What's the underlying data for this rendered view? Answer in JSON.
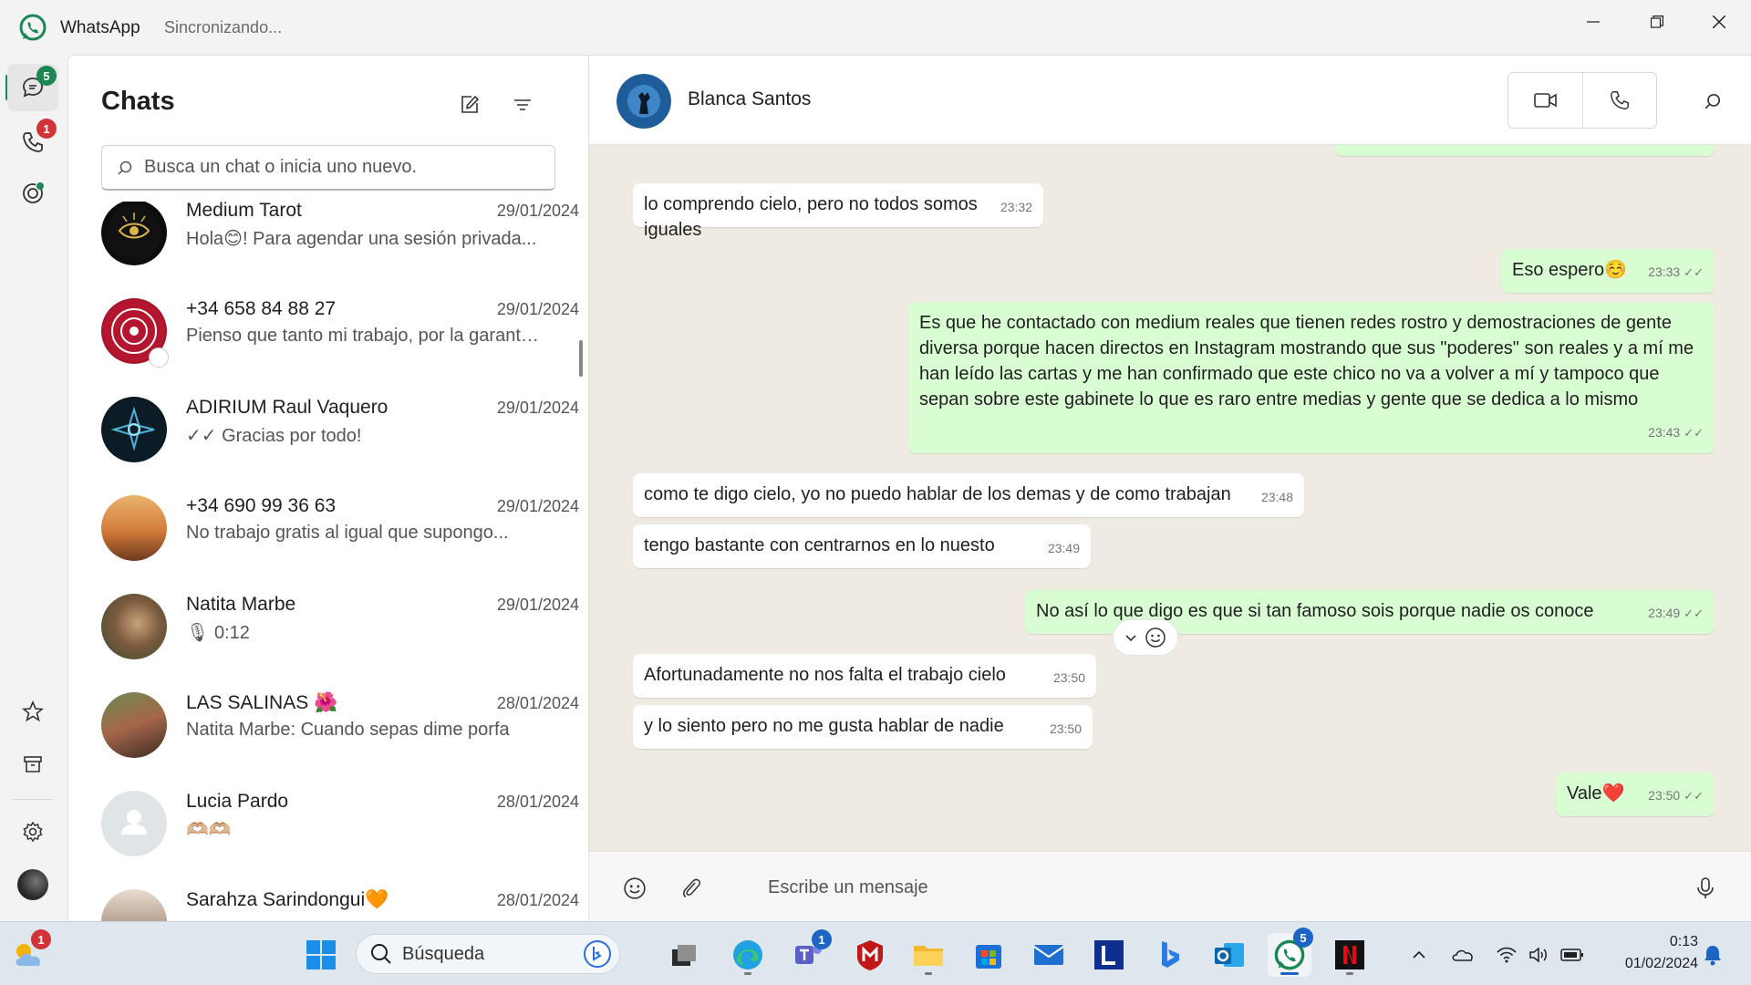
{
  "window": {
    "app_name": "WhatsApp",
    "status": "Sincronizando..."
  },
  "rail": {
    "chats_badge": "5",
    "calls_badge": "1"
  },
  "chatlist": {
    "title": "Chats",
    "search_placeholder": "Busca un chat o inicia uno nuevo.",
    "items": [
      {
        "name": "Medium Tarot",
        "date": "29/01/2024",
        "preview": "Hola😊! Para agendar una sesión privada..."
      },
      {
        "name": "+34 658 84 88 27",
        "date": "29/01/2024",
        "preview": "Pienso que tanto mi trabajo, por la garantía..."
      },
      {
        "name": "ADIRIUM Raul Vaquero",
        "date": "29/01/2024",
        "preview": "✓✓ Gracias por todo!"
      },
      {
        "name": "+34 690 99 36 63",
        "date": "29/01/2024",
        "preview": "No trabajo gratis al igual que supongo..."
      },
      {
        "name": "Natita Marbe",
        "date": "29/01/2024",
        "preview": "🎙 0:12"
      },
      {
        "name": "LAS SALINAS 🌺",
        "date": "28/01/2024",
        "preview": "Natita Marbe: Cuando sepas dime porfa"
      },
      {
        "name": "Lucia Pardo",
        "date": "28/01/2024",
        "preview": "🫶🏼🫶🏼"
      },
      {
        "name": "Sarahza Sarindongui🧡",
        "date": "28/01/2024",
        "preview": ""
      }
    ]
  },
  "conversation": {
    "contact_name": "Blanca Santos",
    "messages": [
      {
        "dir": "in",
        "text": "lo comprendo cielo, pero no todos somos iguales",
        "time": "23:32"
      },
      {
        "dir": "out",
        "text": "Eso espero☺️",
        "time": "23:33"
      },
      {
        "dir": "out",
        "text": "Es que he contactado con medium reales que tienen redes rostro y demostraciones de gente diversa porque hacen directos en Instagram mostrando que sus \"poderes\" son reales y a mí me han leído las cartas y me han confirmado que este chico no va a volver a mí y tampoco que sepan sobre este gabinete lo que es raro entre medias y gente que se dedica a lo mismo",
        "time": "23:43"
      },
      {
        "dir": "in",
        "text": "como te digo cielo, yo no puedo hablar de los demas y de como trabajan",
        "time": "23:48"
      },
      {
        "dir": "in",
        "text": "tengo bastante con centrarnos en lo nuesto",
        "time": "23:49"
      },
      {
        "dir": "out",
        "text": "No así lo que digo es que si tan famoso sois porque nadie os conoce",
        "time": "23:49"
      },
      {
        "dir": "in",
        "text": "Afortunadamente no nos falta el trabajo cielo",
        "time": "23:50"
      },
      {
        "dir": "in",
        "text": "y lo siento pero no me gusta hablar de nadie",
        "time": "23:50"
      },
      {
        "dir": "out",
        "text": "Vale❤️",
        "time": "23:50"
      }
    ],
    "composer_placeholder": "Escribe un mensaje"
  },
  "taskbar": {
    "weather_badge": "1",
    "search_label": "Búsqueda",
    "teams_badge": "1",
    "whatsapp_badge": "5",
    "time": "0:13",
    "date": "01/02/2024"
  },
  "colors": {
    "accent": "#1b8755",
    "outgoing_bubble": "#d9fdd3",
    "badge_red": "#d13438"
  }
}
